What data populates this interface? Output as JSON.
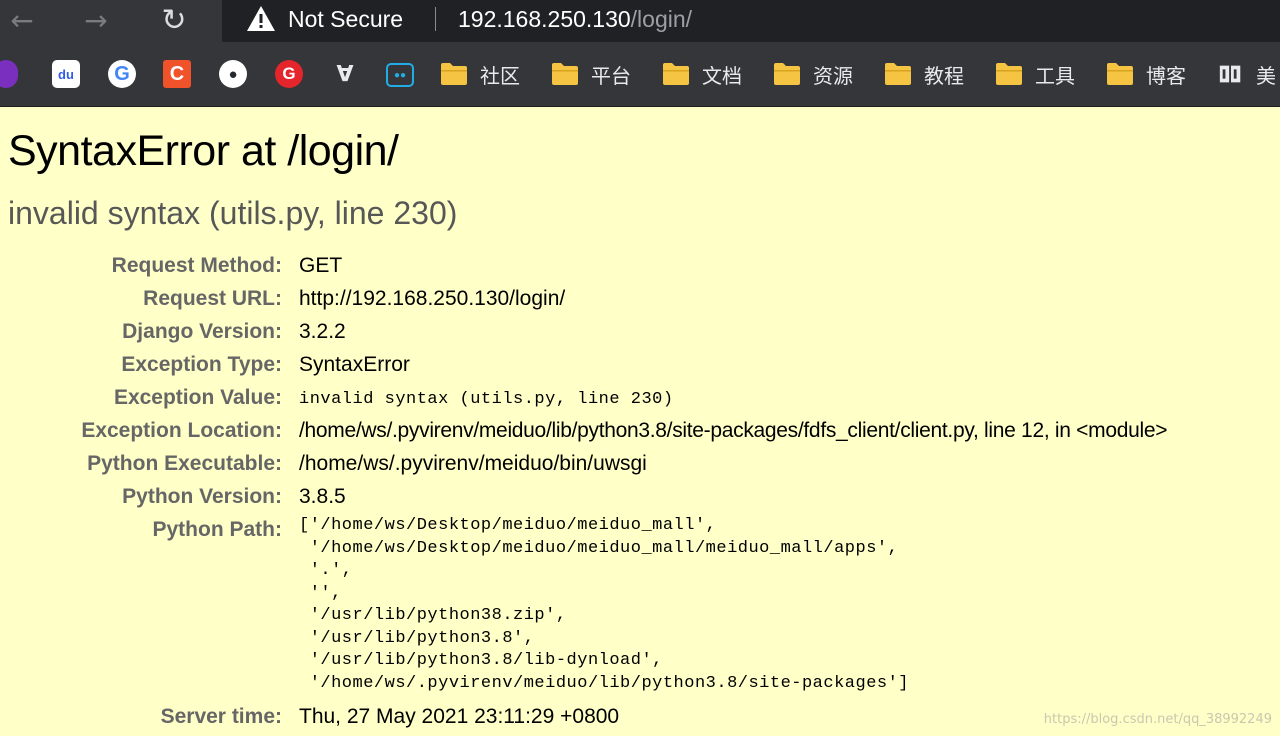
{
  "browser": {
    "not_secure": "Not Secure",
    "url_host": "192.168.250.130",
    "url_path": "/login/",
    "bookmarks": [
      {
        "icon": "music-app-icon",
        "color": "#7b2fbe"
      },
      {
        "icon": "baidu-icon",
        "color": "#2f5ce8"
      },
      {
        "icon": "google-icon",
        "color": "#ffffff"
      },
      {
        "icon": "csdn-icon",
        "color": "#f0522a"
      },
      {
        "icon": "github-icon",
        "color": "#ffffff"
      },
      {
        "icon": "g-app-icon",
        "color": "#e4252c"
      },
      {
        "icon": "dev-tool-icon",
        "color": "#e8eaed"
      },
      {
        "icon": "bilibili-icon",
        "color": "#23ade5"
      }
    ],
    "folders": [
      "社区",
      "平台",
      "文档",
      "资源",
      "教程",
      "工具",
      "博客"
    ],
    "last_bookmark": "美"
  },
  "error": {
    "title": "SyntaxError at /login/",
    "subtitle": "invalid syntax (utils.py, line 230)",
    "rows": [
      {
        "label": "Request Method:",
        "value": "GET"
      },
      {
        "label": "Request URL:",
        "value": "http://192.168.250.130/login/"
      },
      {
        "label": "Django Version:",
        "value": "3.2.2"
      },
      {
        "label": "Exception Type:",
        "value": "SyntaxError"
      },
      {
        "label": "Exception Value:",
        "value": "invalid syntax (utils.py, line 230)"
      },
      {
        "label": "Exception Location:",
        "value": "/home/ws/.pyvirenv/meiduo/lib/python3.8/site-packages/fdfs_client/client.py, line 12, in <module>"
      },
      {
        "label": "Python Executable:",
        "value": "/home/ws/.pyvirenv/meiduo/bin/uwsgi"
      },
      {
        "label": "Python Version:",
        "value": "3.8.5"
      }
    ],
    "python_path_label": "Python Path:",
    "python_path": "['/home/ws/Desktop/meiduo/meiduo_mall',\n '/home/ws/Desktop/meiduo/meiduo_mall/meiduo_mall/apps',\n '.',\n '',\n '/usr/lib/python38.zip',\n '/usr/lib/python3.8',\n '/usr/lib/python3.8/lib-dynload',\n '/home/ws/.pyvirenv/meiduo/lib/python3.8/site-packages']",
    "server_time_label": "Server time:",
    "server_time": "Thu, 27 May 2021 23:11:29 +0800"
  },
  "watermark": "https://blog.csdn.net/qq_38992249"
}
